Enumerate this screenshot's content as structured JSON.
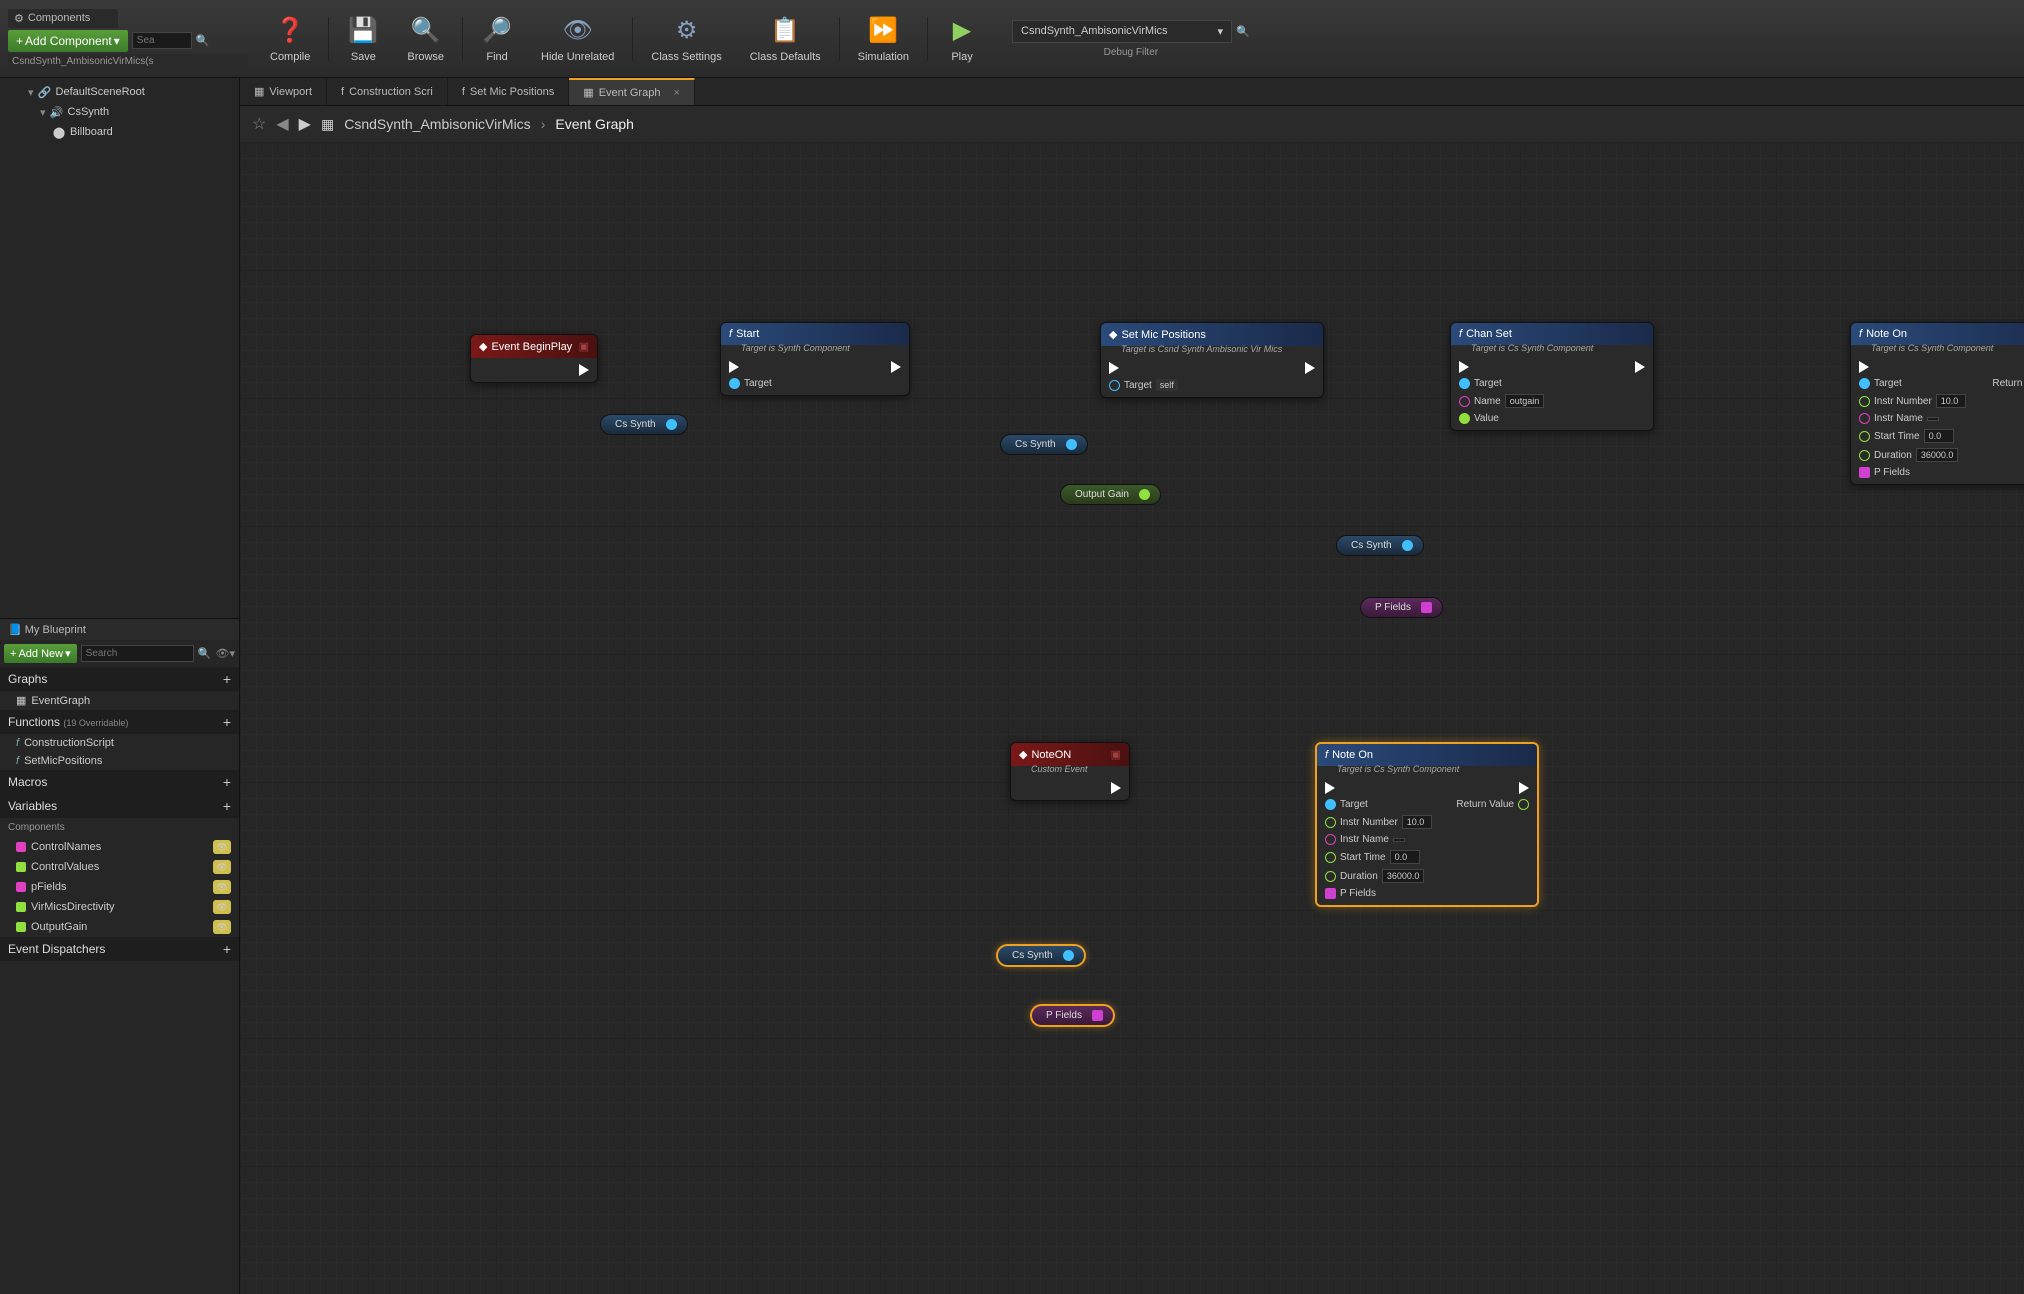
{
  "toolbar": {
    "components_tab": "Components",
    "add_component": "Add Component",
    "search_placeholder": "Sea",
    "selection": "CsndSynth_AmbisonicVirMics(s",
    "buttons": {
      "compile": "Compile",
      "save": "Save",
      "browse": "Browse",
      "find": "Find",
      "hide": "Hide Unrelated",
      "class_settings": "Class Settings",
      "class_defaults": "Class Defaults",
      "simulation": "Simulation",
      "play": "Play"
    },
    "debug_combo": "CsndSynth_AmbisonicVirMics",
    "debug_label": "Debug Filter"
  },
  "tree": {
    "root": "DefaultSceneRoot",
    "child1": "CsSynth",
    "child2": "Billboard"
  },
  "mybp": {
    "tab": "My Blueprint",
    "add_new": "Add New",
    "search_placeholder": "Search",
    "sections": {
      "graphs": "Graphs",
      "functions": "Functions",
      "functions_hint": "(19 Overridable)",
      "macros": "Macros",
      "variables": "Variables",
      "components_sub": "Components",
      "dispatchers": "Event Dispatchers"
    },
    "graphs": [
      "EventGraph"
    ],
    "functions": [
      "ConstructionScript",
      "SetMicPositions"
    ],
    "variables": [
      {
        "name": "ControlNames",
        "color": "#e040c0"
      },
      {
        "name": "ControlValues",
        "color": "#90e040"
      },
      {
        "name": "pFields",
        "color": "#e040c0"
      },
      {
        "name": "VirMicsDirectivity",
        "color": "#90e040"
      },
      {
        "name": "OutputGain",
        "color": "#90e040"
      }
    ]
  },
  "graph_tabs": [
    {
      "label": "Viewport",
      "icon": "▦"
    },
    {
      "label": "Construction Scri",
      "icon": "f"
    },
    {
      "label": "Set Mic Positions",
      "icon": "f"
    },
    {
      "label": "Event Graph",
      "icon": "▦",
      "active": true
    }
  ],
  "breadcrumb": {
    "blueprint": "CsndSynth_AmbisonicVirMics",
    "graph": "Event Graph"
  },
  "nodes": {
    "begin_play": {
      "title": "Event BeginPlay"
    },
    "start": {
      "title": "Start",
      "sub": "Target is Synth Component",
      "pins": {
        "target": "Target"
      }
    },
    "set_mic": {
      "title": "Set Mic Positions",
      "sub": "Target is Csnd Synth Ambisonic Vir Mics",
      "pins": {
        "target": "Target",
        "self": "self"
      }
    },
    "chan_set": {
      "title": "Chan Set",
      "sub": "Target is Cs Synth Component",
      "pins": {
        "target": "Target",
        "name": "Name",
        "name_val": "outgain",
        "value": "Value"
      }
    },
    "note_on1": {
      "title": "Note On",
      "sub": "Target is Cs Synth Component",
      "pins": {
        "target": "Target",
        "return": "Return Value",
        "instr_num": "Instr Number",
        "instr_num_val": "10.0",
        "instr_name": "Instr Name",
        "start_time": "Start Time",
        "start_time_val": "0.0",
        "duration": "Duration",
        "duration_val": "36000.0",
        "pfields": "P Fields"
      }
    },
    "note_on_evt": {
      "title": "NoteON",
      "sub": "Custom Event"
    },
    "note_on2": {
      "title": "Note On",
      "sub": "Target is Cs Synth Component",
      "pins": {
        "target": "Target",
        "return": "Return Value",
        "instr_num": "Instr Number",
        "instr_num_val": "10.0",
        "instr_name": "Instr Name",
        "start_time": "Start Time",
        "start_time_val": "0.0",
        "duration": "Duration",
        "duration_val": "36000.0",
        "pfields": "P Fields"
      }
    },
    "vars": {
      "cs_synth1": "Cs Synth",
      "cs_synth2": "Cs Synth",
      "cs_synth3": "Cs Synth",
      "cs_synth4": "Cs Synth",
      "output_gain": "Output Gain",
      "pfields1": "P Fields",
      "pfields2": "P Fields"
    }
  }
}
